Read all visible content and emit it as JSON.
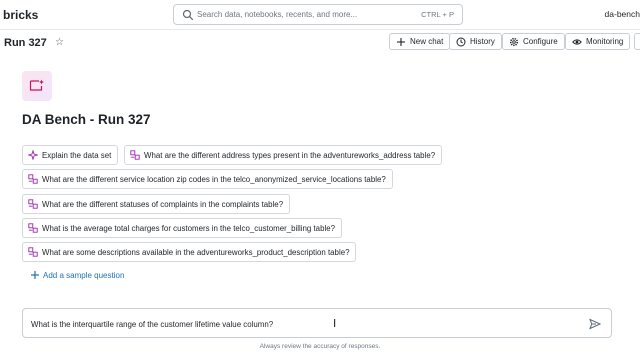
{
  "topbar": {
    "brand": "bricks",
    "search_placeholder": "Search data, notebooks, recents, and more...",
    "search_shortcut": "CTRL + P",
    "workspace": "da-bench"
  },
  "header": {
    "title": "Run 327",
    "buttons": {
      "new_chat": "New chat",
      "history": "History",
      "configure": "Configure",
      "monitoring": "Monitoring"
    }
  },
  "main": {
    "title": "DA Bench - Run 327",
    "sample_questions": [
      "Explain the data set",
      "What are the different address types present in the adventureworks_address table?",
      "What are the different service location zip codes in the telco_anonymized_service_locations table?",
      "What are the different statuses of complaints in the complaints table?",
      "What is the average total charges for customers in the telco_customer_billing table?",
      "What are some descriptions available in the adventureworks_product_description table?"
    ],
    "add_sample_label": "Add a sample question"
  },
  "composer": {
    "value": "What is the interquartile range of the customer lifetime value column?",
    "footnote": "Always review the accuracy of responses."
  },
  "colors": {
    "accent": "#2272b4",
    "logo_icon": "#c2185b",
    "chip_icon": "#9c27b0"
  },
  "icons": {
    "search": "search-icon",
    "star": "star-icon",
    "new_chat": "plus-icon",
    "history": "history-icon",
    "configure": "gear-icon",
    "monitoring": "eye-icon",
    "sample": "table-icon",
    "explain": "sparkle-icon",
    "send": "send-icon"
  }
}
